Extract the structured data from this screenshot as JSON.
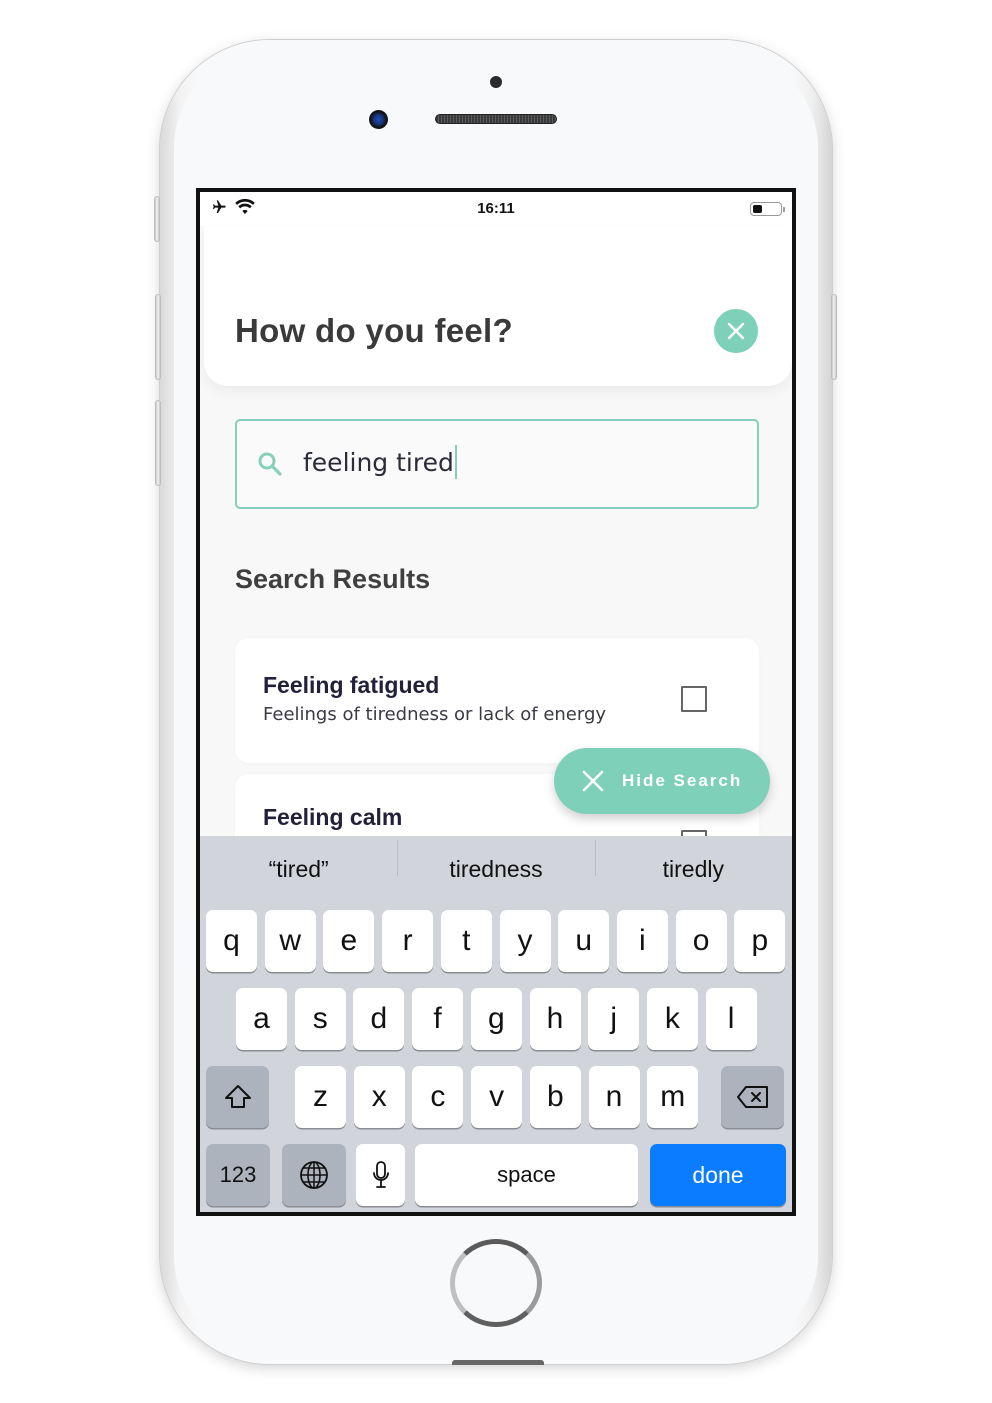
{
  "status_bar": {
    "time": "16:11",
    "icons": [
      "airplane-icon",
      "wifi-icon",
      "battery-icon"
    ],
    "battery_level": 0.35
  },
  "header": {
    "title": "How do you feel?",
    "close_icon": "close-icon"
  },
  "search": {
    "value": "feeling tired",
    "icon": "search-icon"
  },
  "results": {
    "section_title": "Search Results",
    "items": [
      {
        "title": "Feeling fatigued",
        "description": "Feelings of tiredness or lack of energy",
        "checked": false
      },
      {
        "title": "Feeling calm",
        "description": "",
        "checked": false
      }
    ]
  },
  "hide_search_button": {
    "label": "Hide Search",
    "icon": "close-icon"
  },
  "keyboard": {
    "suggestions": [
      "“tired”",
      "tiredness",
      "tiredly"
    ],
    "row1": [
      "q",
      "w",
      "e",
      "r",
      "t",
      "y",
      "u",
      "i",
      "o",
      "p"
    ],
    "row2": [
      "a",
      "s",
      "d",
      "f",
      "g",
      "h",
      "j",
      "k",
      "l"
    ],
    "row3": [
      "z",
      "x",
      "c",
      "v",
      "b",
      "n",
      "m"
    ],
    "numbers_label": "123",
    "space_label": "space",
    "done_label": "done"
  },
  "colors": {
    "accent": "#7fd0b8",
    "done_key": "#0a7cff",
    "title_text": "#3a3a3a"
  }
}
